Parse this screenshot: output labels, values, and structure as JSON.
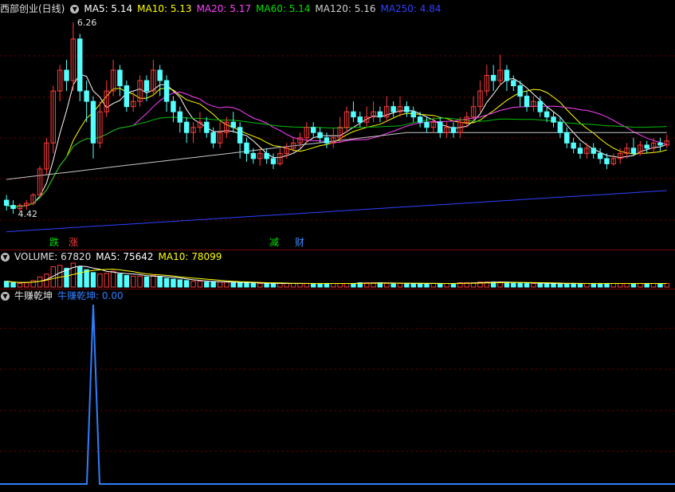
{
  "main_header": {
    "title": "西部创业(日线)",
    "ma5": "MA5: 5.14",
    "ma10": "MA10: 5.13",
    "ma20": "MA20: 5.17",
    "ma60": "MA60: 5.14",
    "ma120": "MA120: 5.16",
    "ma250": "MA250: 4.84"
  },
  "markers": {
    "high": "6.26",
    "low": "4.42",
    "signals": [
      "跌",
      "涨",
      "减",
      "财"
    ]
  },
  "volume_header": {
    "volume": "VOLUME: 67820",
    "ma5": "MA5: 75642",
    "ma10": "MA10: 78099"
  },
  "indicator_header": {
    "name": "牛赚乾坤",
    "value": "牛赚乾坤: 0.00"
  },
  "colors": {
    "up": "#ff3c3c",
    "down": "#54ffff",
    "ma5": "#ffffff",
    "ma10": "#ffff00",
    "ma20": "#ff40ff",
    "ma60": "#00c000",
    "ma120": "#c8c8c8",
    "ma250": "#3040ff",
    "indicator": "#2f7fff"
  },
  "chart_data": {
    "type": "candlestick",
    "price_range": [
      4.42,
      6.26
    ],
    "candles": [
      [
        4.55,
        4.5,
        4.6,
        4.45
      ],
      [
        4.5,
        4.47,
        4.55,
        4.42
      ],
      [
        4.47,
        4.5,
        4.52,
        4.44
      ],
      [
        4.5,
        4.52,
        4.55,
        4.46
      ],
      [
        4.52,
        4.6,
        4.62,
        4.5
      ],
      [
        4.6,
        4.85,
        4.88,
        4.58
      ],
      [
        4.85,
        5.1,
        5.15,
        4.8
      ],
      [
        5.1,
        5.6,
        5.65,
        5.0
      ],
      [
        5.6,
        5.8,
        5.85,
        5.5
      ],
      [
        5.8,
        5.7,
        5.9,
        5.6
      ],
      [
        5.7,
        6.1,
        6.26,
        5.6
      ],
      [
        6.1,
        5.6,
        6.15,
        5.5
      ],
      [
        5.6,
        5.5,
        5.7,
        5.3
      ],
      [
        5.5,
        5.1,
        5.55,
        4.95
      ],
      [
        5.1,
        5.4,
        5.5,
        5.05
      ],
      [
        5.4,
        5.6,
        5.7,
        5.35
      ],
      [
        5.6,
        5.8,
        5.9,
        5.55
      ],
      [
        5.8,
        5.65,
        5.85,
        5.55
      ],
      [
        5.65,
        5.45,
        5.7,
        5.4
      ],
      [
        5.45,
        5.5,
        5.6,
        5.4
      ],
      [
        5.5,
        5.7,
        5.75,
        5.45
      ],
      [
        5.7,
        5.6,
        5.75,
        5.5
      ],
      [
        5.6,
        5.8,
        5.9,
        5.55
      ],
      [
        5.8,
        5.7,
        5.85,
        5.55
      ],
      [
        5.7,
        5.5,
        5.75,
        5.4
      ],
      [
        5.5,
        5.4,
        5.55,
        5.3
      ],
      [
        5.4,
        5.3,
        5.45,
        5.2
      ],
      [
        5.3,
        5.2,
        5.35,
        5.1
      ],
      [
        5.2,
        5.25,
        5.3,
        5.1
      ],
      [
        5.25,
        5.3,
        5.4,
        5.2
      ],
      [
        5.3,
        5.2,
        5.35,
        5.15
      ],
      [
        5.2,
        5.1,
        5.25,
        5.05
      ],
      [
        5.1,
        5.2,
        5.3,
        5.05
      ],
      [
        5.2,
        5.3,
        5.35,
        5.15
      ],
      [
        5.3,
        5.25,
        5.4,
        5.2
      ],
      [
        5.25,
        5.1,
        5.3,
        4.95
      ],
      [
        5.1,
        5.0,
        5.15,
        4.92
      ],
      [
        5.0,
        4.95,
        5.05,
        4.9
      ],
      [
        4.95,
        5.0,
        5.05,
        4.88
      ],
      [
        5.0,
        4.95,
        5.05,
        4.9
      ],
      [
        4.95,
        4.9,
        5.0,
        4.85
      ],
      [
        4.9,
        5.0,
        5.05,
        4.88
      ],
      [
        5.0,
        5.05,
        5.1,
        4.95
      ],
      [
        5.05,
        5.1,
        5.15,
        5.0
      ],
      [
        5.1,
        5.15,
        5.2,
        5.05
      ],
      [
        5.15,
        5.25,
        5.3,
        5.1
      ],
      [
        5.25,
        5.2,
        5.3,
        5.15
      ],
      [
        5.2,
        5.15,
        5.25,
        5.1
      ],
      [
        5.15,
        5.1,
        5.2,
        5.05
      ],
      [
        5.1,
        5.15,
        5.25,
        5.05
      ],
      [
        5.15,
        5.25,
        5.35,
        5.1
      ],
      [
        5.25,
        5.4,
        5.45,
        5.2
      ],
      [
        5.4,
        5.35,
        5.5,
        5.3
      ],
      [
        5.35,
        5.3,
        5.4,
        5.25
      ],
      [
        5.3,
        5.35,
        5.45,
        5.25
      ],
      [
        5.35,
        5.4,
        5.5,
        5.3
      ],
      [
        5.4,
        5.35,
        5.45,
        5.3
      ],
      [
        5.35,
        5.45,
        5.55,
        5.3
      ],
      [
        5.45,
        5.4,
        5.5,
        5.35
      ],
      [
        5.4,
        5.45,
        5.55,
        5.35
      ],
      [
        5.45,
        5.4,
        5.5,
        5.35
      ],
      [
        5.4,
        5.35,
        5.45,
        5.3
      ],
      [
        5.35,
        5.3,
        5.4,
        5.25
      ],
      [
        5.3,
        5.25,
        5.35,
        5.2
      ],
      [
        5.25,
        5.3,
        5.35,
        5.2
      ],
      [
        5.3,
        5.2,
        5.35,
        5.15
      ],
      [
        5.2,
        5.25,
        5.3,
        5.15
      ],
      [
        5.25,
        5.2,
        5.3,
        5.15
      ],
      [
        5.2,
        5.3,
        5.35,
        5.15
      ],
      [
        5.3,
        5.35,
        5.4,
        5.25
      ],
      [
        5.35,
        5.45,
        5.55,
        5.3
      ],
      [
        5.45,
        5.6,
        5.7,
        5.4
      ],
      [
        5.6,
        5.75,
        5.85,
        5.55
      ],
      [
        5.75,
        5.7,
        5.85,
        5.6
      ],
      [
        5.7,
        5.8,
        5.95,
        5.65
      ],
      [
        5.8,
        5.7,
        5.85,
        5.6
      ],
      [
        5.7,
        5.65,
        5.75,
        5.6
      ],
      [
        5.65,
        5.55,
        5.7,
        5.45
      ],
      [
        5.55,
        5.45,
        5.6,
        5.4
      ],
      [
        5.45,
        5.5,
        5.55,
        5.4
      ],
      [
        5.5,
        5.4,
        5.55,
        5.35
      ],
      [
        5.4,
        5.35,
        5.45,
        5.3
      ],
      [
        5.35,
        5.3,
        5.4,
        5.25
      ],
      [
        5.3,
        5.2,
        5.35,
        5.15
      ],
      [
        5.2,
        5.1,
        5.25,
        5.05
      ],
      [
        5.1,
        5.05,
        5.15,
        5.0
      ],
      [
        5.05,
        5.0,
        5.1,
        4.95
      ],
      [
        5.0,
        5.05,
        5.1,
        4.95
      ],
      [
        5.05,
        5.0,
        5.1,
        4.95
      ],
      [
        5.0,
        4.95,
        5.05,
        4.9
      ],
      [
        4.95,
        4.9,
        5.0,
        4.85
      ],
      [
        4.9,
        4.95,
        5.0,
        4.88
      ],
      [
        4.95,
        5.0,
        5.05,
        4.9
      ],
      [
        5.0,
        5.05,
        5.1,
        4.95
      ],
      [
        5.05,
        5.0,
        5.15,
        4.98
      ],
      [
        5.0,
        5.08,
        5.12,
        4.98
      ],
      [
        5.08,
        5.05,
        5.12,
        5.0
      ],
      [
        5.05,
        5.1,
        5.15,
        5.0
      ],
      [
        5.1,
        5.08,
        5.15,
        5.02
      ],
      [
        5.08,
        5.12,
        5.18,
        5.05
      ]
    ],
    "volume": [
      8,
      6,
      5,
      6,
      9,
      14,
      18,
      28,
      30,
      26,
      33,
      28,
      24,
      20,
      18,
      19,
      22,
      18,
      16,
      15,
      15,
      14,
      16,
      14,
      12,
      11,
      10,
      9,
      8,
      8,
      7,
      7,
      7,
      7,
      6,
      6,
      6,
      5,
      5,
      5,
      5,
      5,
      5,
      5,
      5,
      5,
      5,
      5,
      5,
      5,
      5,
      5,
      5,
      6,
      6,
      6,
      6,
      5,
      5,
      5,
      5,
      5,
      5,
      5,
      5,
      5,
      5,
      5,
      6,
      6,
      6,
      7,
      7,
      7,
      7,
      6,
      6,
      6,
      5,
      5,
      5,
      5,
      5,
      5,
      5,
      5,
      5,
      5,
      5,
      5,
      5,
      5,
      5,
      5,
      5,
      5,
      5,
      5,
      5,
      5
    ],
    "indicator": {
      "spike_index": 13,
      "spike_value": 1.0,
      "baseline": 0.0
    }
  }
}
